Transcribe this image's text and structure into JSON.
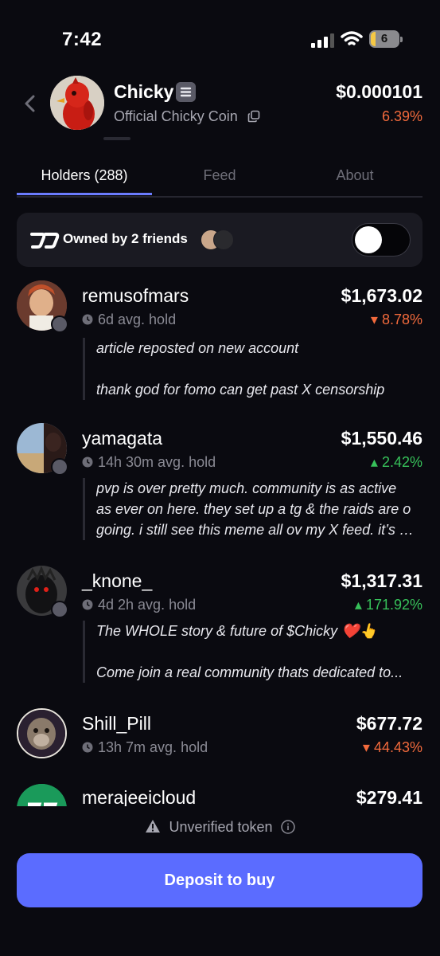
{
  "status": {
    "time": "7:42",
    "battery": "6"
  },
  "coin": {
    "name": "Chicky",
    "subtitle": "Official Chicky Coin",
    "price": "$0.000101",
    "change": "6.39%"
  },
  "tabs": [
    {
      "label": "Holders (288)"
    },
    {
      "label": "Feed"
    },
    {
      "label": "About"
    }
  ],
  "friends": {
    "label": "Owned by 2 friends",
    "toggle_on": false
  },
  "holders": [
    {
      "name": "remusofmars",
      "hold": "6d avg. hold",
      "value": "$1,673.02",
      "change": "▾ 8.78%",
      "comment": [
        "article reposted on new account",
        "",
        "thank god for fomo can get past X censorship"
      ]
    },
    {
      "name": "yamagata",
      "hold": "14h 30m avg. hold",
      "value": "$1,550.46",
      "change": "▴ 2.42%",
      "comment": [
        "pvp is over pretty much. community is as active",
        "as ever on here. they set up a tg & the raids are o",
        "going. i still see this meme all ov my X feed. it’s ti..."
      ]
    },
    {
      "name": "_knone_",
      "hold": "4d 2h avg. hold",
      "value": "$1,317.31",
      "change": "▴ 171.92%",
      "comment": [
        "The WHOLE story & future of $Chicky ❤️👆",
        "",
        "Come join a real community thats dedicated to..."
      ]
    },
    {
      "name": "Shill_Pill",
      "hold": "13h 7m avg. hold",
      "value": "$677.72",
      "change": "▾ 44.43%"
    },
    {
      "name": "merajeeicloud",
      "value": "$279.41"
    }
  ],
  "footer": {
    "unverified": "Unverified token",
    "deposit": "Deposit to buy"
  },
  "colors": {
    "accent": "#5b6cff",
    "down": "#f26a3c",
    "up": "#37c15a"
  }
}
